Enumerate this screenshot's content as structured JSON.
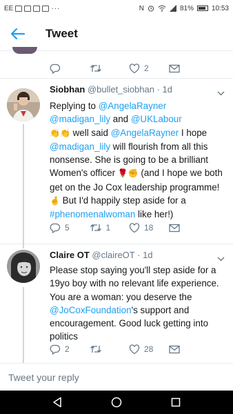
{
  "status_bar": {
    "carrier_icons": "EE",
    "nfc": "N",
    "battery_percent": "81%",
    "time": "10:53"
  },
  "header": {
    "title": "Tweet",
    "back_icon": "arrow-left-icon"
  },
  "prev_tweet": {
    "likes": "2"
  },
  "tweets": [
    {
      "name": "Siobhan",
      "handle": "@bullet_siobhan",
      "time": "· 1d",
      "replying_prefix": "Replying to ",
      "replying_to_1": "@AngelaRayner",
      "replying_to_2": "@madigan_lily",
      "replying_and": " and ",
      "replying_to_3": "@UKLabour",
      "body_1": " well said ",
      "mention_1": "@AngelaRayner",
      "body_2": " I hope ",
      "mention_2": "@madigan_lily",
      "body_3": " will flourish from all this nonsense. She is going to be a brilliant Women's officer ",
      "body_4": " (and I hope we both get on the Jo Cox leadership programme! ",
      "body_5": " But I'd happily step aside for a ",
      "hashtag": "#phenomenalwoman",
      "body_6": " like her!)",
      "replies": "5",
      "retweets": "1",
      "likes": "18"
    },
    {
      "name": "Claire OT",
      "handle": "@claireOT",
      "time": "· 1d",
      "body_1": "Please stop saying you'll step aside for a 19yo boy with no relevant life experience. You are a woman: you deserve the ",
      "mention_1": "@JoCoxFoundation",
      "body_2": "'s support and encouragement. Good luck getting into politics",
      "replies": "2",
      "retweets": "",
      "likes": "28"
    }
  ],
  "reply_bar": {
    "placeholder": "Tweet your reply"
  },
  "colors": {
    "accent": "#1da1f2",
    "text": "#14171a",
    "muted": "#657786"
  }
}
